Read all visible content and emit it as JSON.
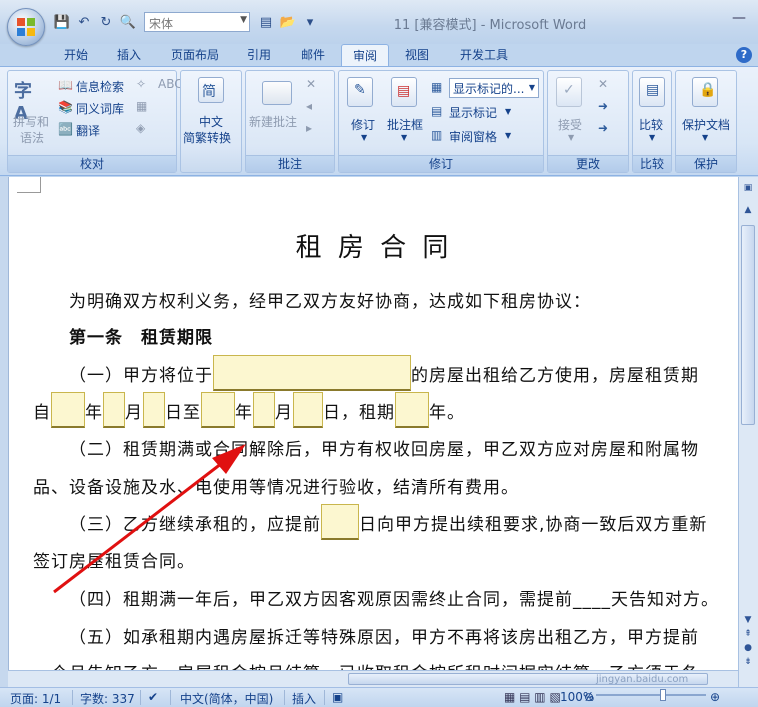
{
  "window": {
    "title": "11 [兼容模式] - Microsoft Word"
  },
  "qat": {
    "font_name": "宋体"
  },
  "tabs": [
    "开始",
    "插入",
    "页面布局",
    "引用",
    "邮件",
    "审阅",
    "视图",
    "开发工具"
  ],
  "ribbon": {
    "proofing": {
      "label": "校对",
      "spelling": "拼写和",
      "spelling2": "语法",
      "research": "信息检索",
      "thesaurus": "同义词库",
      "translate": "翻译"
    },
    "chinese": {
      "label": "中文",
      "label2": "简繁转换"
    },
    "comments": {
      "label": "批注",
      "new_comment": "新建批注"
    },
    "tracking": {
      "label": "修订",
      "track_changes": "修订",
      "balloons": "批注框",
      "show_markup_select": "显示标记的...",
      "show_markup": "显示标记",
      "reviewing_pane": "审阅窗格"
    },
    "changes": {
      "label": "更改",
      "accept": "接受"
    },
    "compare": {
      "label": "比较"
    },
    "protect": {
      "label": "保护",
      "protect_doc": "保护文档"
    }
  },
  "document": {
    "title": "租 房 合 同",
    "intro": "为明确双方权利义务，经甲乙双方友好协商，达成如下租房协议：",
    "article1": "第一条　租赁期限",
    "p1a": "（一）甲方将位于",
    "p1a_tail": "的房屋出租给乙方使用，房屋租赁期",
    "p1b": [
      "自",
      "年",
      "月",
      "日至",
      "年",
      "月",
      "日，租期",
      "年。"
    ],
    "p2a": "（二）租赁期满或合同解除后，甲方有权收回房屋，甲乙双方应对房屋和附属物",
    "p2b": "品、设备设施及水、电使用等情况进行验收，结清所有费用。",
    "p3a": "（三）乙方继续承租的，应提前",
    "p3a_tail": "日向甲方提出续租要求,协商一致后双方重新",
    "p3b": "签订房屋租赁合同。",
    "p4": "（四）租期满一年后，甲乙双方因客观原因需终止合同，需提前____天告知对方。",
    "p5": "（五）如承租期内遇房屋拆迁等特殊原因，甲方不再将该房出租乙方，甲方提前",
    "p6": "一个月告知乙方，房屋租金按月结算，已收取租金按所租时间据实结算，乙方须于冬"
  },
  "status": {
    "page": "页面: 1/1",
    "words": "字数: 337",
    "language": "中文(简体，中国)",
    "insert": "插入",
    "zoom": "100%",
    "zoom_level": 1.0
  },
  "watermark": "jingyan.baidu.com",
  "colors": {
    "arrow": "#e01010",
    "accent": "#15428b"
  }
}
